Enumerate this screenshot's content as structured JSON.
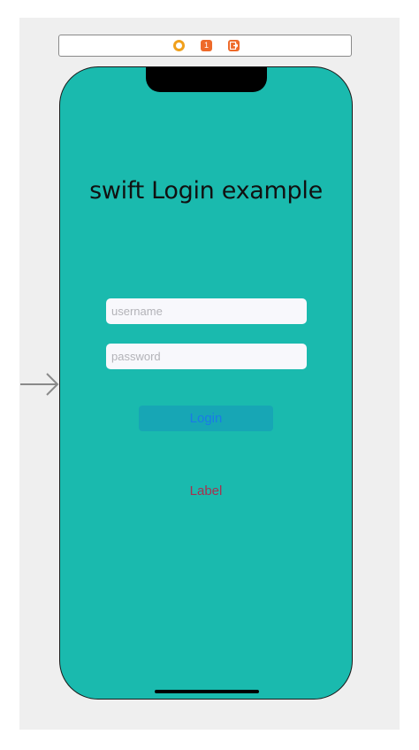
{
  "scene_bar": {
    "icons": [
      "view-controller-icon",
      "first-responder-icon",
      "exit-icon"
    ],
    "first_responder_text": "1"
  },
  "screen": {
    "title": "swift Login example",
    "username_placeholder": "username",
    "password_placeholder": "password",
    "login_label": "Login",
    "label_text": "Label"
  },
  "colors": {
    "screen_background": "#1abaae",
    "login_button_background": "#17a6b5",
    "login_button_text": "#1a7be6",
    "label_text": "#a6324f"
  }
}
